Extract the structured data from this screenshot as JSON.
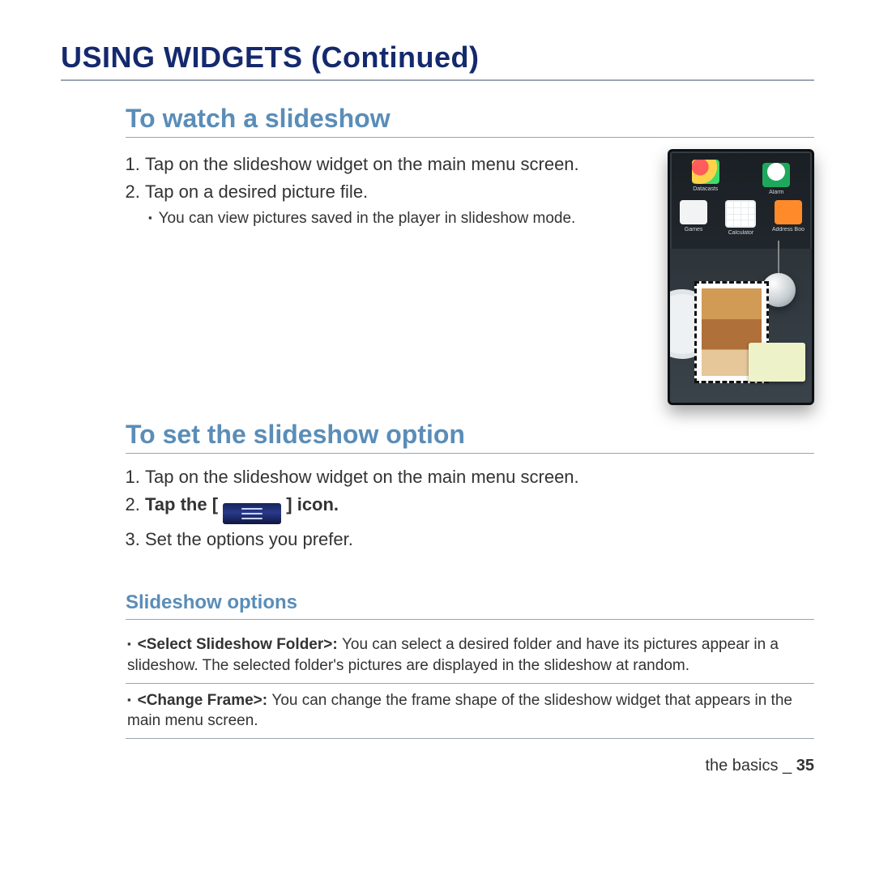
{
  "page_title": "USING WIDGETS (Continued)",
  "section1": {
    "heading": "To watch a slideshow",
    "steps": [
      {
        "text": "Tap on the slideshow widget on the main menu screen."
      },
      {
        "text": "Tap on a desired picture file.",
        "note": "You can view pictures saved in the player in slideshow mode."
      }
    ]
  },
  "device_icons": {
    "datacasts": "Datacasts",
    "alarm": "Alarm",
    "games": "Games",
    "calculator": "Calculator",
    "address_book": "Address Book"
  },
  "section2": {
    "heading": "To set the slideshow option",
    "step1": "Tap on the slideshow widget on the main menu screen.",
    "step2_prefix": "Tap the [ ",
    "step2_suffix": " ] icon.",
    "step3": "Set the options you prefer."
  },
  "options_heading": "Slideshow options",
  "options": [
    {
      "label": "<Select Slideshow Folder>: ",
      "desc": "You can select a desired folder and have its pictures appear in a slideshow. The selected folder's pictures are displayed in the slideshow at random."
    },
    {
      "label": "<Change Frame>: ",
      "desc": " You can change the frame shape of the slideshow widget that appears in the main menu screen."
    }
  ],
  "footer": {
    "section": "the basics",
    "sep": " _ ",
    "page": "35"
  }
}
